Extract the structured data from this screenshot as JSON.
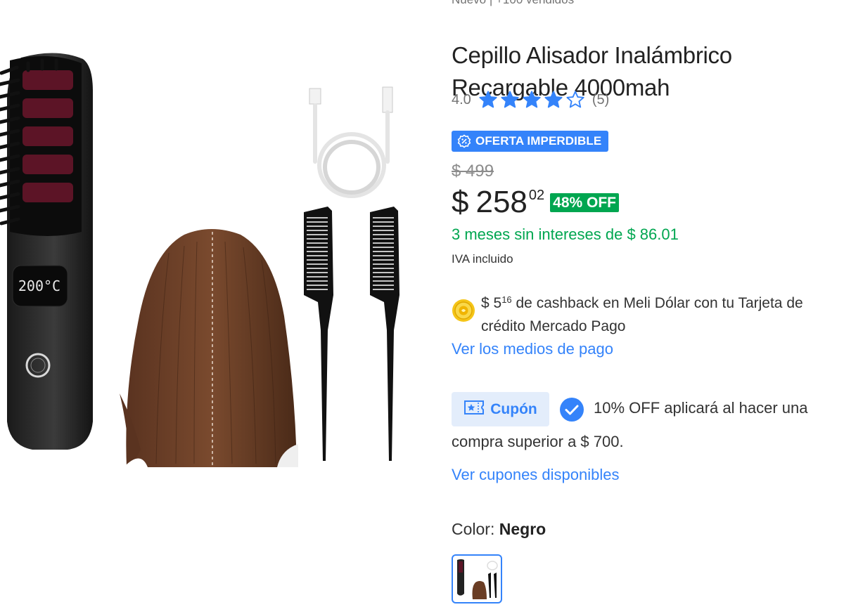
{
  "product": {
    "subtitle": "Nuevo  |  +100 vendidos",
    "title": "Cepillo Alisador Inalámbrico Recargable 4000mah",
    "rating": "4.0",
    "rating_value": 4,
    "rating_max": 5,
    "review_count": "(5)",
    "deal_badge": "OFERTA IMPERDIBLE",
    "old_price": "$ 499",
    "price_symbol": "$",
    "price_integer": "258",
    "price_cents": "02",
    "discount": "48% OFF",
    "installments": "3 meses sin intereses de $ 86.01",
    "tax_note": "IVA incluido"
  },
  "image": {
    "display_text": "200°C"
  },
  "cashback": {
    "prefix": "$ 5",
    "cents": "16",
    "text_line1": " de cashback en Meli Dólar con tu Tarjeta de",
    "text_line2": "crédito Mercado Pago"
  },
  "payment_link": "Ver los medios de pago",
  "coupon": {
    "label": "Cupón",
    "text_line1": "10% OFF aplicará al hacer una",
    "text_line2": "compra superior a $ 700.",
    "link": "Ver cupones disponibles"
  },
  "color": {
    "label": "Color: ",
    "value": "Negro"
  },
  "colors": {
    "accent": "#3483fa",
    "green": "#00a650",
    "badge_bg": "#3483fa",
    "coupon_bg": "#e3edfb"
  }
}
